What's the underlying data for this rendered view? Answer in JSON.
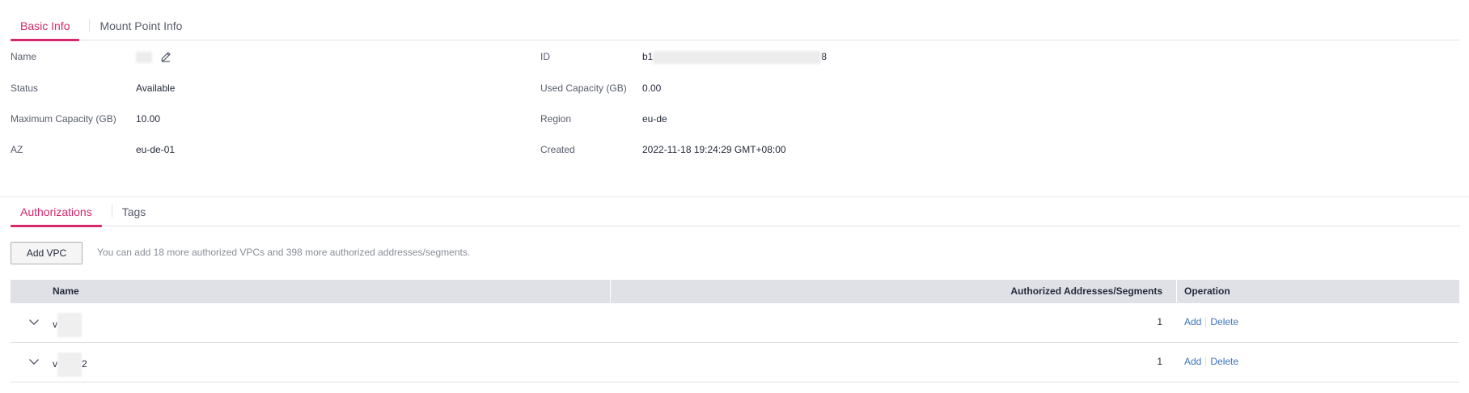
{
  "top_tabs": [
    {
      "label": "Basic Info",
      "active": true
    },
    {
      "label": "Mount Point Info",
      "active": false
    }
  ],
  "basic_info": {
    "left": [
      {
        "label": "Name",
        "value": ""
      },
      {
        "label": "Status",
        "value": "Available"
      },
      {
        "label": "Maximum Capacity (GB)",
        "value": "10.00"
      },
      {
        "label": "AZ",
        "value": "eu-de-01"
      }
    ],
    "right": [
      {
        "label": "ID",
        "value_prefix": "b1",
        "value_suffix": "8"
      },
      {
        "label": "Used Capacity (GB)",
        "value": "0.00"
      },
      {
        "label": "Region",
        "value": "eu-de"
      },
      {
        "label": "Created",
        "value": "2022-11-18 19:24:29 GMT+08:00"
      }
    ]
  },
  "bottom_tabs": [
    {
      "label": "Authorizations",
      "active": true
    },
    {
      "label": "Tags",
      "active": false
    }
  ],
  "authorizations": {
    "add_button": "Add VPC",
    "hint": "You can add 18 more authorized VPCs and 398 more authorized addresses/segments.",
    "columns": [
      "Name",
      "Authorized Addresses/Segments",
      "Operation"
    ],
    "rows": [
      {
        "name_prefix": "v",
        "name_suffix": "",
        "count": "1",
        "ops": [
          "Add",
          "Delete"
        ]
      },
      {
        "name_prefix": "v",
        "name_suffix": "2",
        "count": "1",
        "ops": [
          "Add",
          "Delete"
        ]
      }
    ]
  },
  "colors": {
    "accent": "#d6286b",
    "link": "#3c73b9",
    "header_bg": "#dfe1e6"
  },
  "icons": {
    "edit": "edit-pencil-icon",
    "expand": "chevron-down-icon"
  }
}
